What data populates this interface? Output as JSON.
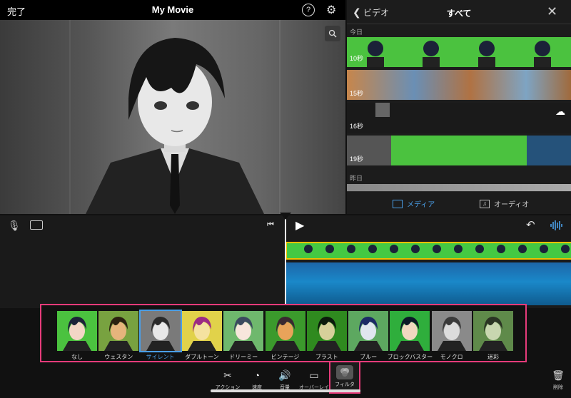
{
  "viewer": {
    "done_label": "完了",
    "title": "My Movie",
    "help_glyph": "?",
    "settings_glyph": "⚙"
  },
  "browser": {
    "back_label": "ビデオ",
    "title": "すべて",
    "close_glyph": "✕",
    "section_today": "今日",
    "section_yesterday": "昨日",
    "clips": [
      {
        "duration": "10秒"
      },
      {
        "duration": "15秒"
      },
      {
        "duration": "16秒"
      },
      {
        "duration": "19秒"
      }
    ],
    "tab_media": "メディア",
    "tab_audio": "オーディオ"
  },
  "filters": [
    {
      "label": "なし",
      "bg": "#4bc23f",
      "skin": "#f3d6c6",
      "hair": "#1c2238"
    },
    {
      "label": "ウェスタン",
      "bg": "#78a240",
      "skin": "#e6b47c",
      "hair": "#2b2010"
    },
    {
      "label": "サイレント",
      "bg": "#7a7a7a",
      "skin": "#e8e8e8",
      "hair": "#2a2a2a",
      "selected": true
    },
    {
      "label": "ダブルトーン",
      "bg": "#e1d24a",
      "skin": "#f5e2a0",
      "hair": "#9c2a84"
    },
    {
      "label": "ドリーミー",
      "bg": "#6fb86d",
      "skin": "#f7e6dc",
      "hair": "#3b4a5e"
    },
    {
      "label": "ビンテージ",
      "bg": "#3b9a2c",
      "skin": "#e8a35a",
      "hair": "#3a2830"
    },
    {
      "label": "ブラスト",
      "bg": "#2f8a1f",
      "skin": "#d7d09a",
      "hair": "#0c1a0c"
    },
    {
      "label": "ブルー",
      "bg": "#5da860",
      "skin": "#e0e6ef",
      "hair": "#1b2a66"
    },
    {
      "label": "ブロックバスター",
      "bg": "#2fae3c",
      "skin": "#f0d8c0",
      "hair": "#0c1a28"
    },
    {
      "label": "モノクロ",
      "bg": "#8a8a8a",
      "skin": "#dcdcdc",
      "hair": "#3a3a3a"
    },
    {
      "label": "迷彩",
      "bg": "#5f8a4a",
      "skin": "#c8d6b0",
      "hair": "#2b3424"
    }
  ],
  "toolbar": {
    "action_label": "アクション",
    "speed_label": "速度",
    "volume_label": "音量",
    "overlay_label": "オーバーレイ",
    "filter_label": "フィルタ",
    "delete_label": "削除"
  }
}
